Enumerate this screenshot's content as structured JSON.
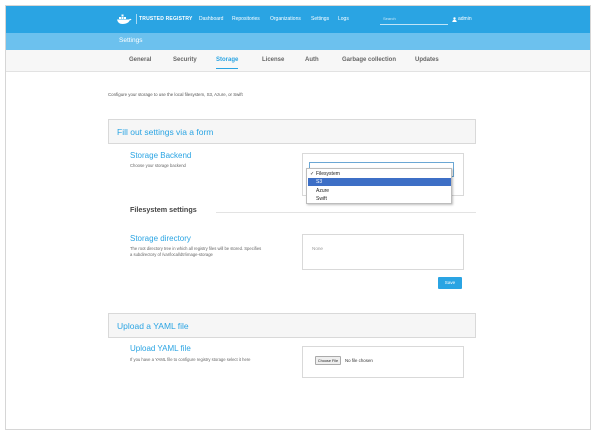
{
  "app": {
    "brand": "TRUSTED REGISTRY",
    "nav": [
      "Dashboard",
      "Repositories",
      "Organizations",
      "Settings",
      "Logs"
    ],
    "search_placeholder": "Search",
    "user": "admin"
  },
  "settings": {
    "title": "Settings",
    "tabs": [
      "General",
      "Security",
      "Storage",
      "License",
      "Auth",
      "Garbage collection",
      "Updates"
    ],
    "active_tab": "Storage"
  },
  "storage": {
    "description": "Configure your storage to use the local filesystem, S3, Azure, or Swift",
    "form_card_title": "Fill out settings via a form",
    "backend": {
      "title": "Storage Backend",
      "help": "Choose your storage backend",
      "options": [
        "Filesystem",
        "S3",
        "Azure",
        "Swift"
      ],
      "selected": "Filesystem",
      "highlighted": "S3",
      "check": "✓"
    },
    "filesystem_heading": "Filesystem settings",
    "directory": {
      "title": "Storage directory",
      "help_line1": "The root directory tree in which all registry files will be stored. Specifies",
      "help_line2": "a subdirectory of /var/local/dtr/image-storage",
      "placeholder": "None"
    },
    "save_label": "Save",
    "yaml_card_title": "Upload a YAML file",
    "upload": {
      "title": "Upload YAML file",
      "help": "If you have a YAML file to configure registry storage select it here",
      "choose_label": "Choose File",
      "no_file": "No file chosen"
    }
  },
  "colors": {
    "accent": "#2aa4e3",
    "settings_bar": "#6cc1ee",
    "highlight": "#3d6fc6"
  },
  "icons": [
    "docker-logo-icon",
    "user-icon"
  ]
}
